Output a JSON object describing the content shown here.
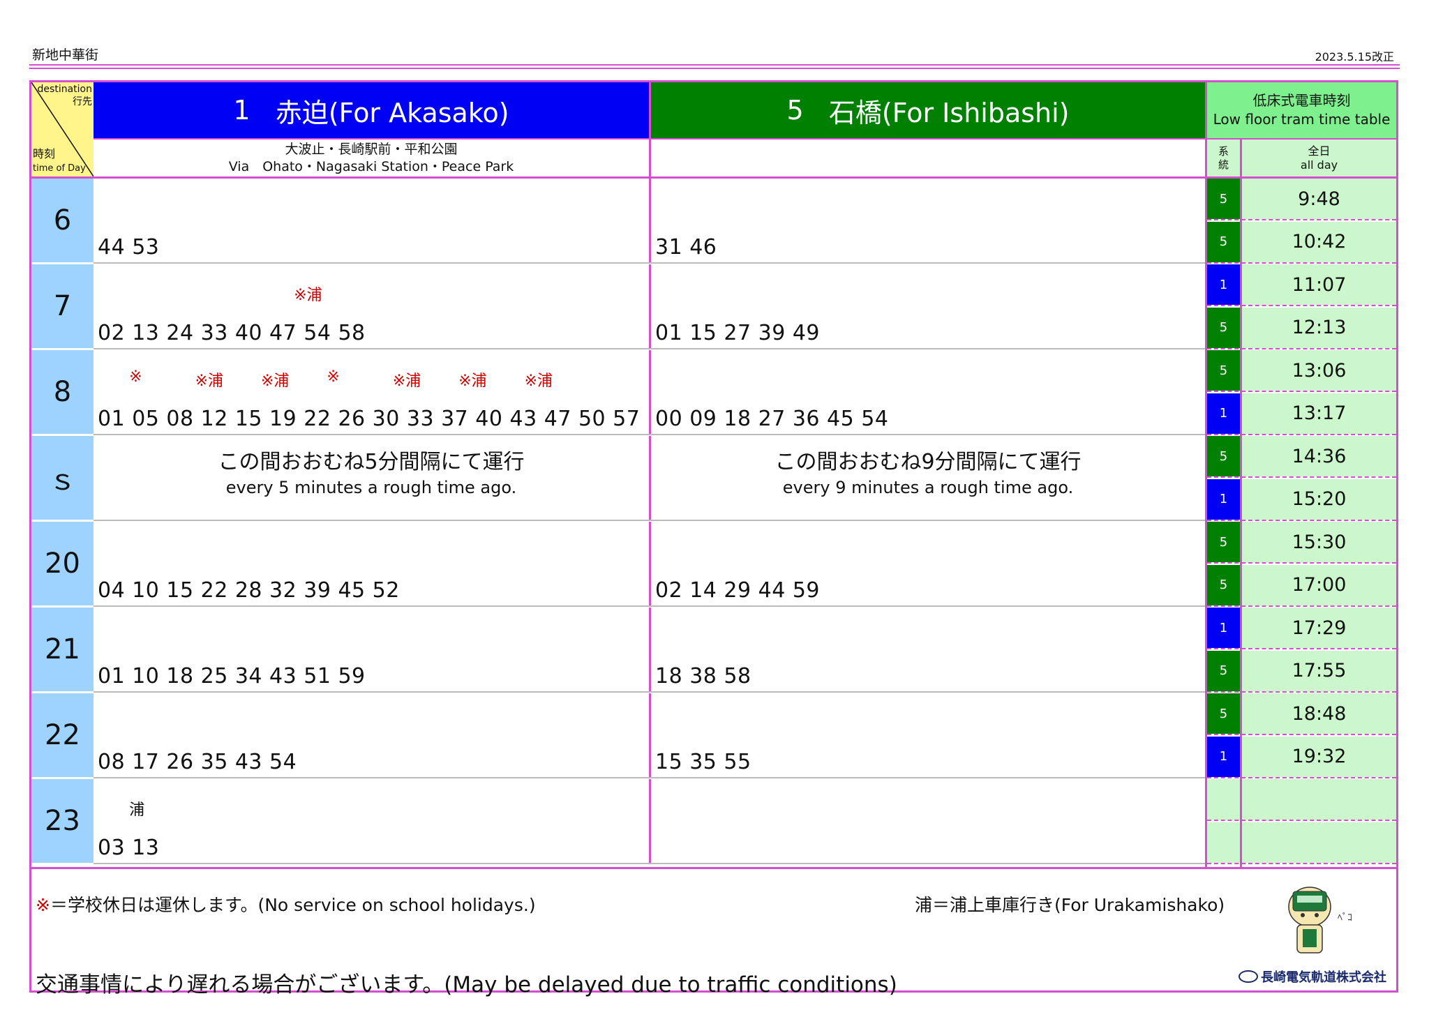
{
  "stop_name": "新地中華街",
  "revision": "2023.5.15改正",
  "corner": {
    "destination_en": "destination",
    "destination_jp": "行先",
    "time_jp": "時刻",
    "time_en": "time of Day"
  },
  "routes": [
    {
      "number": "1",
      "name": "赤迫(For Akasako)",
      "color": "#0000f5",
      "via_jp": "大波止・長崎駅前・平和公園",
      "via_en": "Via　Ohato・Nagasaki Station・Peace Park"
    },
    {
      "number": "5",
      "name": "石橋(For Ishibashi)",
      "color": "#008000",
      "via_jp": "",
      "via_en": ""
    }
  ],
  "hours": [
    {
      "hour": "6",
      "r1": "44 53",
      "r5": "31 46",
      "notes1": []
    },
    {
      "hour": "7",
      "r1": "02 13 24 33 40 47 54 58",
      "r5": "01 15 27 39 49",
      "notes1": [
        {
          "text": "※浦",
          "red": true,
          "col": 6
        }
      ]
    },
    {
      "hour": "8",
      "r1": "01 05 08 12 15 19 22 26 30 33 37 40 43 47 50 57",
      "r5": "00 09 18 27 36 45 54",
      "notes1": [
        {
          "text": "※",
          "red": true,
          "col": 1
        },
        {
          "text": "※浦",
          "red": true,
          "col": 3
        },
        {
          "text": "※浦",
          "red": true,
          "col": 5
        },
        {
          "text": "※",
          "red": true,
          "col": 7
        },
        {
          "text": "※浦",
          "red": true,
          "col": 9
        },
        {
          "text": "※浦",
          "red": true,
          "col": 11
        },
        {
          "text": "※浦",
          "red": true,
          "col": 13
        }
      ]
    },
    {
      "hour": "ｓ",
      "interval": true,
      "r1_jp": "この間おおむね5分間隔にて運行",
      "r1_en": "every 5 minutes a rough time ago.",
      "r5_jp": "この間おおむね9分間隔にて運行",
      "r5_en": "every 9 minutes a rough time ago."
    },
    {
      "hour": "20",
      "r1": "04 10 15 22 28 32 39 45 52",
      "r5": "02 14 29 44 59",
      "notes1": []
    },
    {
      "hour": "21",
      "r1": "01 10 18 25 34 43 51 59",
      "r5": "18 38 58",
      "notes1": []
    },
    {
      "hour": "22",
      "r1": "08 17 26 35 43 54",
      "r5": "15 35 55",
      "notes1": []
    },
    {
      "hour": "23",
      "r1": "03 13",
      "r5": "",
      "notes1": [
        {
          "text": "浦",
          "red": false,
          "col": 1
        }
      ]
    }
  ],
  "low_floor": {
    "title_jp": "低床式電車時刻",
    "title_en": "Low floor tram time table",
    "system_label": "系統",
    "all_jp": "全日",
    "all_en": "all day",
    "trips": [
      {
        "route": "5",
        "time": "9:48"
      },
      {
        "route": "5",
        "time": "10:42"
      },
      {
        "route": "1",
        "time": "11:07"
      },
      {
        "route": "5",
        "time": "12:13"
      },
      {
        "route": "5",
        "time": "13:06"
      },
      {
        "route": "1",
        "time": "13:17"
      },
      {
        "route": "5",
        "time": "14:36"
      },
      {
        "route": "1",
        "time": "15:20"
      },
      {
        "route": "5",
        "time": "15:30"
      },
      {
        "route": "5",
        "time": "17:00"
      },
      {
        "route": "1",
        "time": "17:29"
      },
      {
        "route": "5",
        "time": "17:55"
      },
      {
        "route": "5",
        "time": "18:48"
      },
      {
        "route": "1",
        "time": "19:32"
      },
      {
        "route": "",
        "time": ""
      },
      {
        "route": "",
        "time": ""
      }
    ]
  },
  "footer": {
    "note_school_mark": "※",
    "note_school": "＝学校休日は運休します。(No service on school holidays.)",
    "note_ura": "浦＝浦上車庫行き(For Urakamishako)",
    "note_delay": "交通事情により遅れる場合がございます。(May be delayed due to traffic conditions)",
    "company": "長崎電気軌道株式会社"
  },
  "colors": {
    "border": "#d34fcf",
    "hour_bg": "#9fd3ff",
    "corner_bg": "#fff58a",
    "lf_header": "#7ef08e",
    "lf_cell": "#ccf7cc",
    "route1": "#0000f5",
    "route5": "#008000",
    "note_red": "#d00000"
  }
}
